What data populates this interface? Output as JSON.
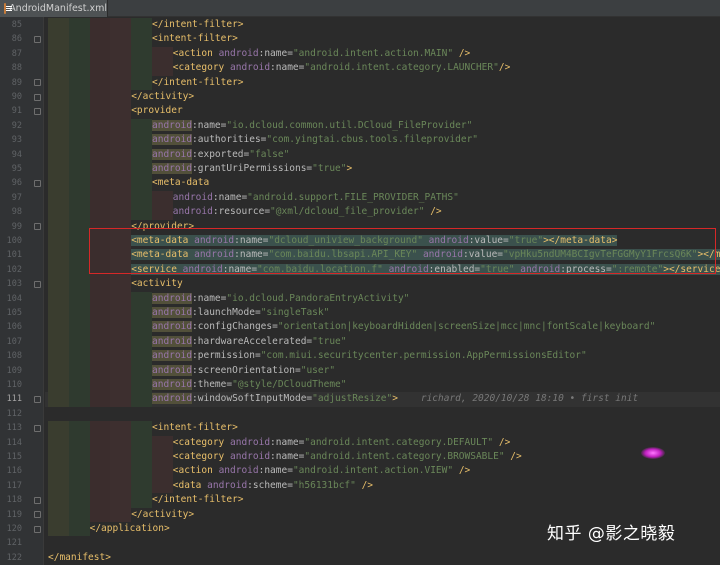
{
  "tab": {
    "title": "AndroidManifest.xml",
    "icon": "xml-file-icon"
  },
  "current_line": 111,
  "lines": [
    {
      "n": 85,
      "i": 5,
      "c": [
        [
          "tag",
          "</intent-filter>"
        ]
      ]
    },
    {
      "n": 86,
      "i": 5,
      "c": [
        [
          "tag",
          "<intent-filter>"
        ]
      ]
    },
    {
      "n": 87,
      "i": 6,
      "c": [
        [
          "tag",
          "<action "
        ],
        [
          "ans",
          "android"
        ],
        [
          "attr",
          ":name="
        ],
        [
          "val",
          "\"android.intent.action.MAIN\""
        ],
        [
          "tag",
          " />"
        ]
      ]
    },
    {
      "n": 88,
      "i": 6,
      "c": [
        [
          "tag",
          "<category "
        ],
        [
          "ans",
          "android"
        ],
        [
          "attr",
          ":name="
        ],
        [
          "val",
          "\"android.intent.category.LAUNCHER\""
        ],
        [
          "tag",
          "/>"
        ]
      ]
    },
    {
      "n": 89,
      "i": 5,
      "c": [
        [
          "tag",
          "</intent-filter>"
        ]
      ]
    },
    {
      "n": 90,
      "i": 4,
      "c": [
        [
          "tag",
          "</activity>"
        ]
      ]
    },
    {
      "n": 91,
      "i": 4,
      "c": [
        [
          "tag",
          "<provider"
        ]
      ]
    },
    {
      "n": 92,
      "i": 5,
      "c": [
        [
          "ans",
          "android"
        ],
        [
          "attr",
          ":name="
        ],
        [
          "val",
          "\"io.dcloud.common.util.DCloud_FileProvider\""
        ]
      ]
    },
    {
      "n": 93,
      "i": 5,
      "c": [
        [
          "ans",
          "android"
        ],
        [
          "attr",
          ":authorities="
        ],
        [
          "val",
          "\"com.yingtai.cbus.tools.fileprovider\""
        ]
      ]
    },
    {
      "n": 94,
      "i": 5,
      "c": [
        [
          "ans",
          "android"
        ],
        [
          "attr",
          ":exported="
        ],
        [
          "val",
          "\"false\""
        ]
      ]
    },
    {
      "n": 95,
      "i": 5,
      "c": [
        [
          "ans",
          "android"
        ],
        [
          "attr",
          ":grantUriPermissions="
        ],
        [
          "val",
          "\"true\""
        ],
        [
          "tag",
          ">"
        ]
      ]
    },
    {
      "n": 96,
      "i": 5,
      "c": [
        [
          "tag",
          "<meta-data"
        ]
      ]
    },
    {
      "n": 97,
      "i": 6,
      "c": [
        [
          "ans",
          "android"
        ],
        [
          "attr",
          ":name="
        ],
        [
          "val",
          "\"android.support.FILE_PROVIDER_PATHS\""
        ]
      ]
    },
    {
      "n": 98,
      "i": 6,
      "c": [
        [
          "ans",
          "android"
        ],
        [
          "attr",
          ":resource="
        ],
        [
          "val",
          "\"@xml/dcloud_file_provider\""
        ],
        [
          "tag",
          " />"
        ]
      ]
    },
    {
      "n": 99,
      "i": 4,
      "c": [
        [
          "tag",
          "</provider>"
        ]
      ]
    },
    {
      "n": 100,
      "i": 4,
      "c": [
        [
          "tag",
          "<meta-data "
        ],
        [
          "ans",
          "android"
        ],
        [
          "attr",
          ":name="
        ],
        [
          "val",
          "\"dcloud_uniview_background\""
        ],
        [
          "attr",
          " "
        ],
        [
          "ans",
          "android"
        ],
        [
          "attr",
          ":value="
        ],
        [
          "val",
          "\"true\""
        ],
        [
          "tag",
          "></meta-data>"
        ]
      ]
    },
    {
      "n": 101,
      "i": 4,
      "c": [
        [
          "tag",
          "<meta-data "
        ],
        [
          "ans",
          "android"
        ],
        [
          "attr",
          ":name="
        ],
        [
          "val",
          "\"com.baidu.lbsapi.API_KEY\""
        ],
        [
          "attr",
          " "
        ],
        [
          "ans",
          "android"
        ],
        [
          "attr",
          ":value="
        ],
        [
          "val",
          "\"vpHku5ndUM4BCIgvTeFGGMyY1FrcsQ6K\""
        ],
        [
          "tag",
          "></meta-data>"
        ]
      ]
    },
    {
      "n": 102,
      "i": 4,
      "c": [
        [
          "tag",
          "<service "
        ],
        [
          "ans",
          "android"
        ],
        [
          "attr",
          ":name="
        ],
        [
          "val",
          "\"com.baidu.location.f\""
        ],
        [
          "attr",
          " "
        ],
        [
          "ans",
          "android"
        ],
        [
          "attr",
          ":enabled="
        ],
        [
          "val",
          "\"true\""
        ],
        [
          "attr",
          " "
        ],
        [
          "ans",
          "android"
        ],
        [
          "attr",
          ":process="
        ],
        [
          "val",
          "\":remote\""
        ],
        [
          "tag",
          "></service>"
        ]
      ]
    },
    {
      "n": 103,
      "i": 4,
      "c": [
        [
          "tag",
          "<activity"
        ]
      ]
    },
    {
      "n": 104,
      "i": 5,
      "c": [
        [
          "ans",
          "android"
        ],
        [
          "attr",
          ":name="
        ],
        [
          "val",
          "\"io.dcloud.PandoraEntryActivity\""
        ]
      ]
    },
    {
      "n": 105,
      "i": 5,
      "c": [
        [
          "ans",
          "android"
        ],
        [
          "attr",
          ":launchMode="
        ],
        [
          "val",
          "\"singleTask\""
        ]
      ]
    },
    {
      "n": 106,
      "i": 5,
      "c": [
        [
          "ans",
          "android"
        ],
        [
          "attr",
          ":configChanges="
        ],
        [
          "val",
          "\"orientation|keyboardHidden|screenSize|mcc|mnc|fontScale|keyboard\""
        ]
      ]
    },
    {
      "n": 107,
      "i": 5,
      "c": [
        [
          "ans",
          "android"
        ],
        [
          "attr",
          ":hardwareAccelerated="
        ],
        [
          "val",
          "\"true\""
        ]
      ]
    },
    {
      "n": 108,
      "i": 5,
      "c": [
        [
          "ans",
          "android"
        ],
        [
          "attr",
          ":permission="
        ],
        [
          "val",
          "\"com.miui.securitycenter.permission.AppPermissionsEditor\""
        ]
      ]
    },
    {
      "n": 109,
      "i": 5,
      "c": [
        [
          "ans",
          "android"
        ],
        [
          "attr",
          ":screenOrientation="
        ],
        [
          "val",
          "\"user\""
        ]
      ]
    },
    {
      "n": 110,
      "i": 5,
      "c": [
        [
          "ans",
          "android"
        ],
        [
          "attr",
          ":theme="
        ],
        [
          "val",
          "\"@style/DCloudTheme\""
        ]
      ]
    },
    {
      "n": 111,
      "i": 5,
      "c": [
        [
          "ans",
          "android"
        ],
        [
          "attr",
          ":windowSoftInputMode="
        ],
        [
          "val",
          "\"adjustResize\""
        ],
        [
          "tag",
          ">"
        ],
        [
          "blame",
          "    richard, 2020/10/28 18:10 • first init"
        ]
      ]
    },
    {
      "n": 112,
      "i": 0,
      "c": []
    },
    {
      "n": 113,
      "i": 5,
      "c": [
        [
          "tag",
          "<intent-filter>"
        ]
      ]
    },
    {
      "n": 114,
      "i": 6,
      "c": [
        [
          "tag",
          "<category "
        ],
        [
          "ans",
          "android"
        ],
        [
          "attr",
          ":name="
        ],
        [
          "val",
          "\"android.intent.category.DEFAULT\""
        ],
        [
          "tag",
          " />"
        ]
      ]
    },
    {
      "n": 115,
      "i": 6,
      "c": [
        [
          "tag",
          "<category "
        ],
        [
          "ans",
          "android"
        ],
        [
          "attr",
          ":name="
        ],
        [
          "val",
          "\"android.intent.category.BROWSABLE\""
        ],
        [
          "tag",
          " />"
        ]
      ]
    },
    {
      "n": 116,
      "i": 6,
      "c": [
        [
          "tag",
          "<action "
        ],
        [
          "ans",
          "android"
        ],
        [
          "attr",
          ":name="
        ],
        [
          "val",
          "\"android.intent.action.VIEW\""
        ],
        [
          "tag",
          " />"
        ]
      ]
    },
    {
      "n": 117,
      "i": 6,
      "c": [
        [
          "tag",
          "<data "
        ],
        [
          "ans",
          "android"
        ],
        [
          "attr",
          ":scheme="
        ],
        [
          "val",
          "\"h56131bcf\""
        ],
        [
          "tag",
          " />"
        ]
      ]
    },
    {
      "n": 118,
      "i": 5,
      "c": [
        [
          "tag",
          "</intent-filter>"
        ]
      ]
    },
    {
      "n": 119,
      "i": 4,
      "c": [
        [
          "tag",
          "</activity>"
        ]
      ]
    },
    {
      "n": 120,
      "i": 2,
      "c": [
        [
          "tag",
          "</application>"
        ]
      ]
    },
    {
      "n": 121,
      "i": 0,
      "c": []
    },
    {
      "n": 122,
      "i": 0,
      "c": [
        [
          "tag",
          "</manifest>"
        ]
      ]
    }
  ],
  "highlighted_lines": [
    100,
    101,
    102
  ],
  "watermark": "知乎 @影之晓毅",
  "colors": {
    "tag": "#e8bf6a",
    "namespace": "#9876aa",
    "attribute": "#bababa",
    "value": "#6a8759",
    "highlight_box": "#d62828"
  }
}
